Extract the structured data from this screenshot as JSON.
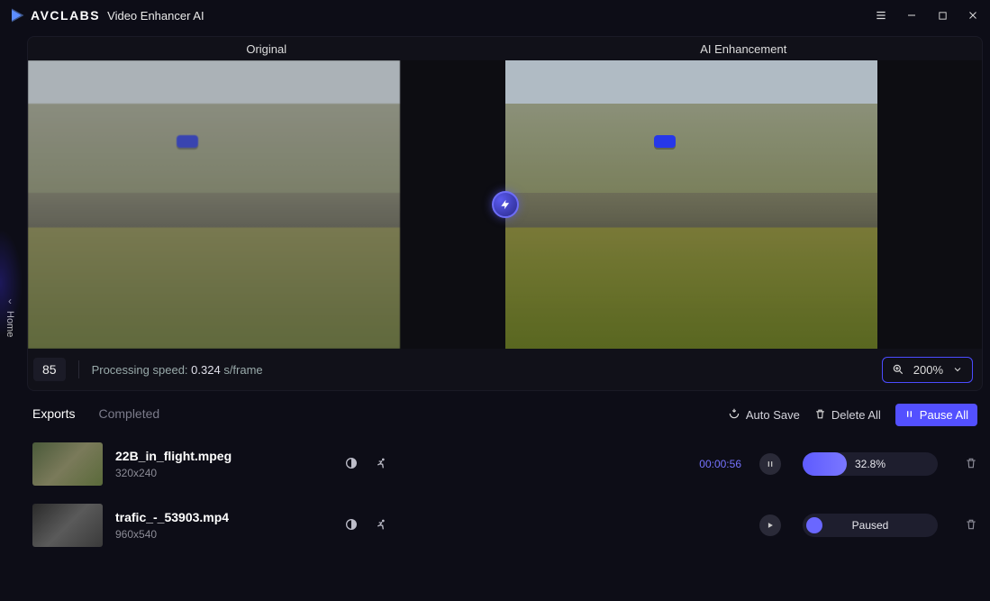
{
  "app": {
    "brand": "AVCLABS",
    "subtitle": "Video Enhancer AI"
  },
  "sidebar": {
    "home_label": "Home"
  },
  "compare": {
    "left_label": "Original",
    "right_label": "AI Enhancement"
  },
  "status": {
    "frame": "85",
    "speed_prefix": "Processing speed: ",
    "speed_value": "0.324",
    "speed_unit": " s/frame",
    "zoom": "200%"
  },
  "exports": {
    "tabs": {
      "exports": "Exports",
      "completed": "Completed"
    },
    "autosave": "Auto Save",
    "delete_all": "Delete All",
    "pause_all": "Pause All",
    "items": [
      {
        "name": "22B_in_flight.mpeg",
        "resolution": "320x240",
        "time": "00:00:56",
        "state": "running",
        "progress_pct": 32.8,
        "progress_label": "32.8%"
      },
      {
        "name": "trafic_-_53903.mp4",
        "resolution": "960x540",
        "time": "",
        "state": "paused",
        "progress_pct": 0,
        "progress_label": "Paused"
      }
    ]
  }
}
